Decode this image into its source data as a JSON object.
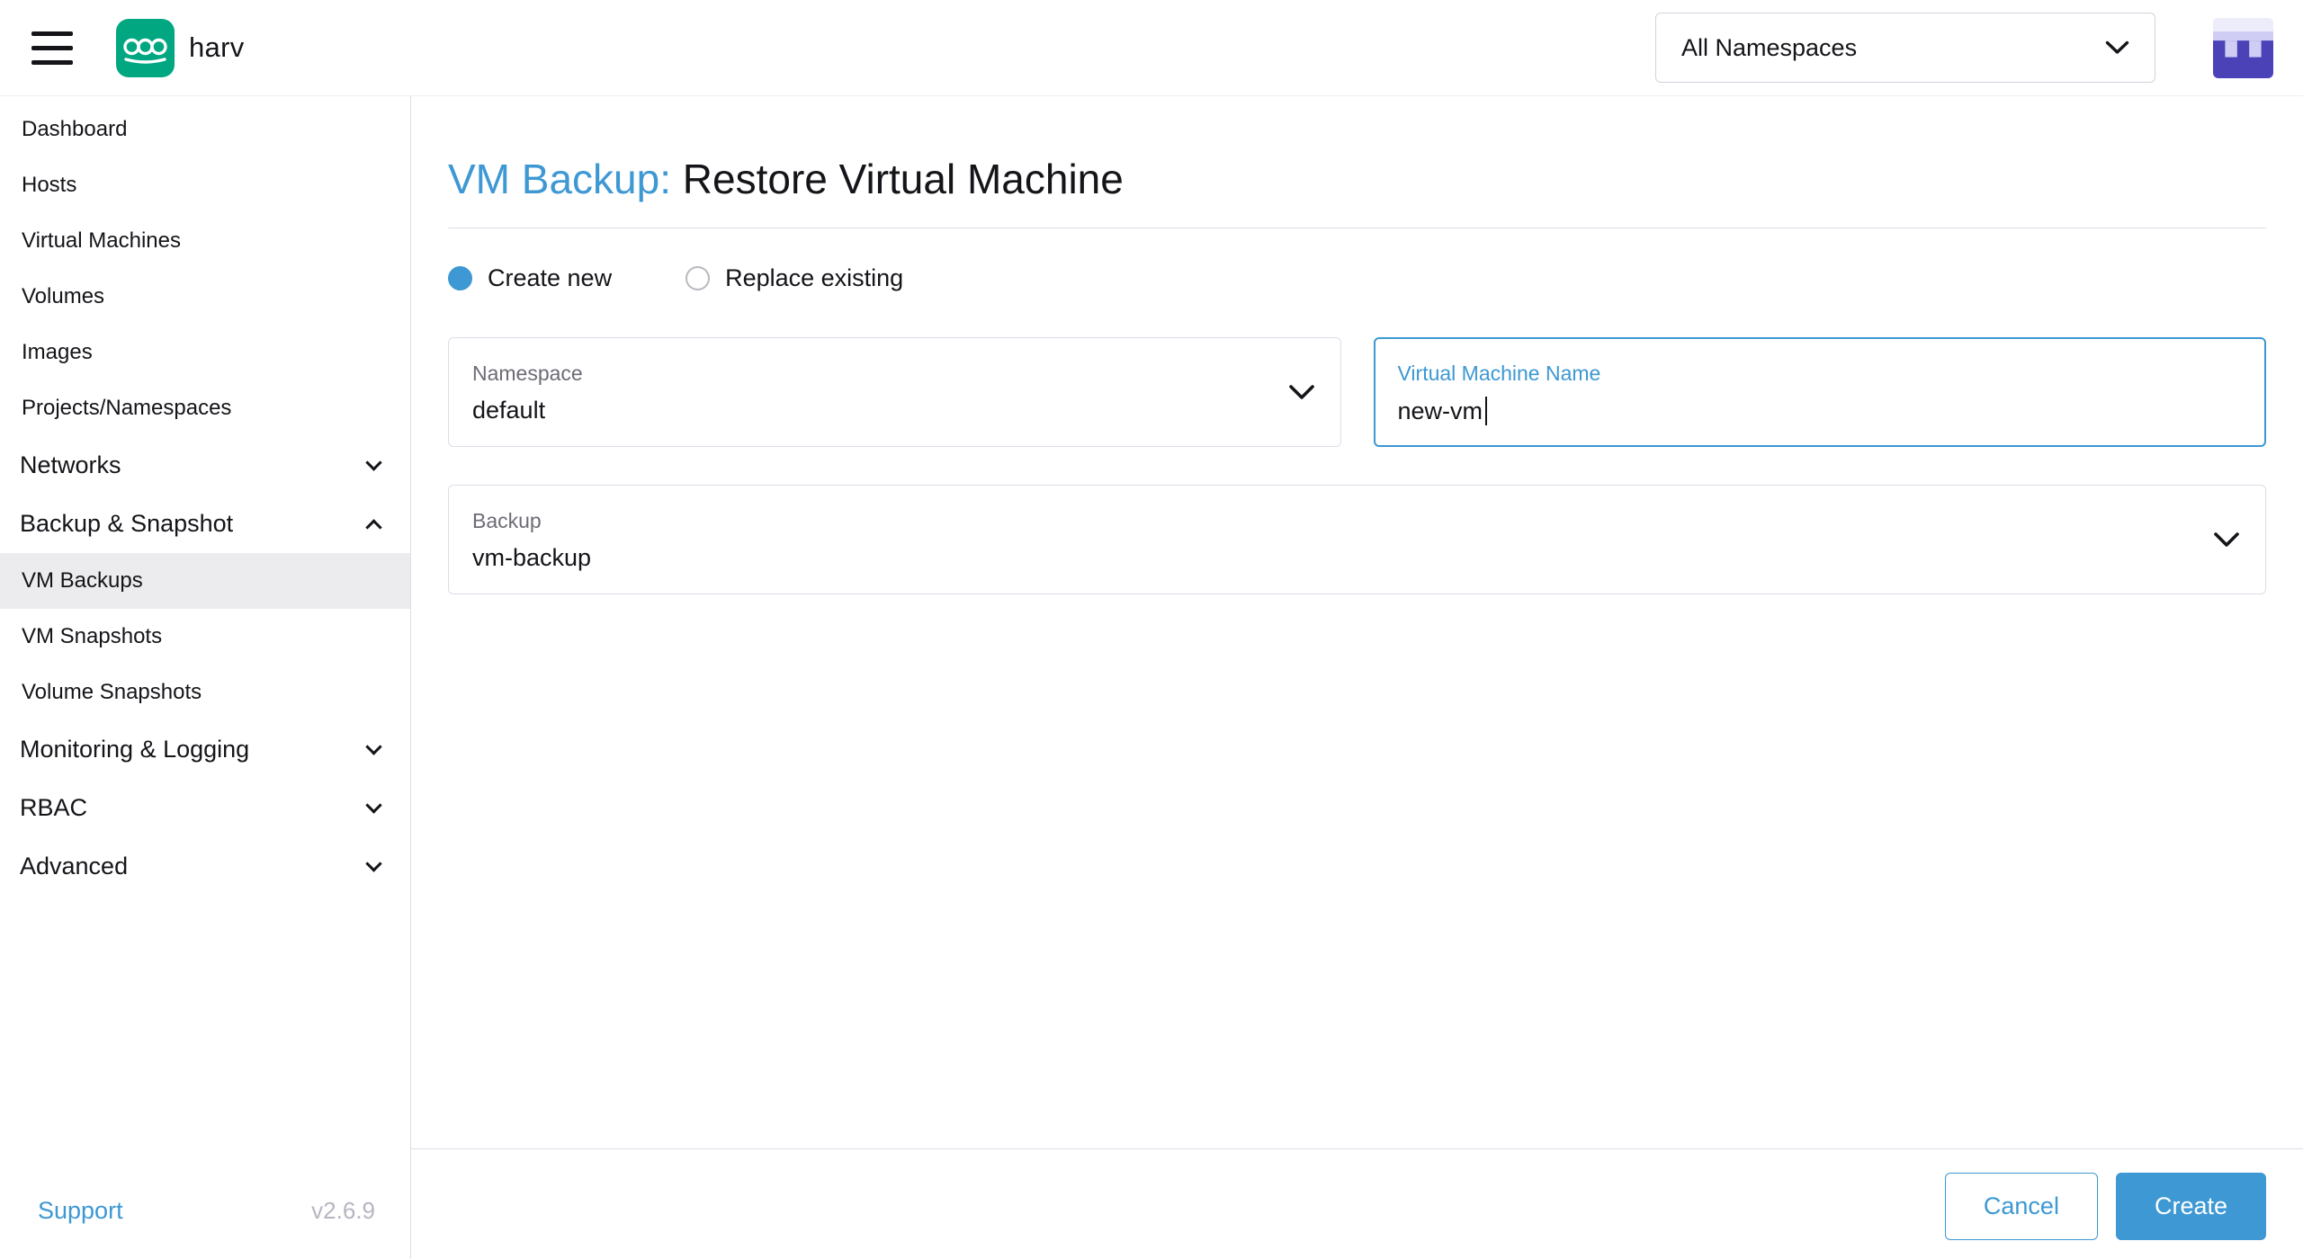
{
  "header": {
    "brand": "harv",
    "namespace_dropdown": "All Namespaces"
  },
  "sidebar": {
    "items": [
      "Dashboard",
      "Hosts",
      "Virtual Machines",
      "Volumes",
      "Images",
      "Projects/Namespaces"
    ],
    "groups": [
      {
        "label": "Networks",
        "expanded": false
      },
      {
        "label": "Backup & Snapshot",
        "expanded": true
      },
      {
        "label": "Monitoring & Logging",
        "expanded": false
      },
      {
        "label": "RBAC",
        "expanded": false
      },
      {
        "label": "Advanced",
        "expanded": false
      }
    ],
    "backup_children": [
      "VM Backups",
      "VM Snapshots",
      "Volume Snapshots"
    ],
    "active_item": "VM Backups",
    "footer": {
      "support": "Support",
      "version": "v2.6.9"
    }
  },
  "page": {
    "title_prefix": "VM Backup:",
    "title_text": "Restore Virtual Machine",
    "radios": [
      {
        "label": "Create new",
        "selected": true
      },
      {
        "label": "Replace existing",
        "selected": false
      }
    ],
    "fields": {
      "namespace": {
        "label": "Namespace",
        "value": "default"
      },
      "vm_name": {
        "label": "Virtual Machine Name",
        "value": "new-vm"
      },
      "backup": {
        "label": "Backup",
        "value": "vm-backup"
      }
    },
    "actions": {
      "cancel": "Cancel",
      "create": "Create"
    }
  },
  "icons": {
    "menu": "hamburger-bars",
    "brand_logo": "harvester-green-rounded-square",
    "dropdown_chevron": "chevron-down",
    "group_collapsed": "chevron-down",
    "group_expanded": "chevron-up",
    "avatar": "identicon-blocks"
  },
  "colors": {
    "primary": "#3d98d3",
    "logo_green": "#00a781",
    "border": "#dcdee7",
    "text": "#141419",
    "label_gray": "#6c6c76",
    "version_gray": "#b6b6c2",
    "active_item_bg": "#ececee",
    "avatar_indigo": "#4c42b8",
    "avatar_lavender": "#cfcdf4"
  }
}
